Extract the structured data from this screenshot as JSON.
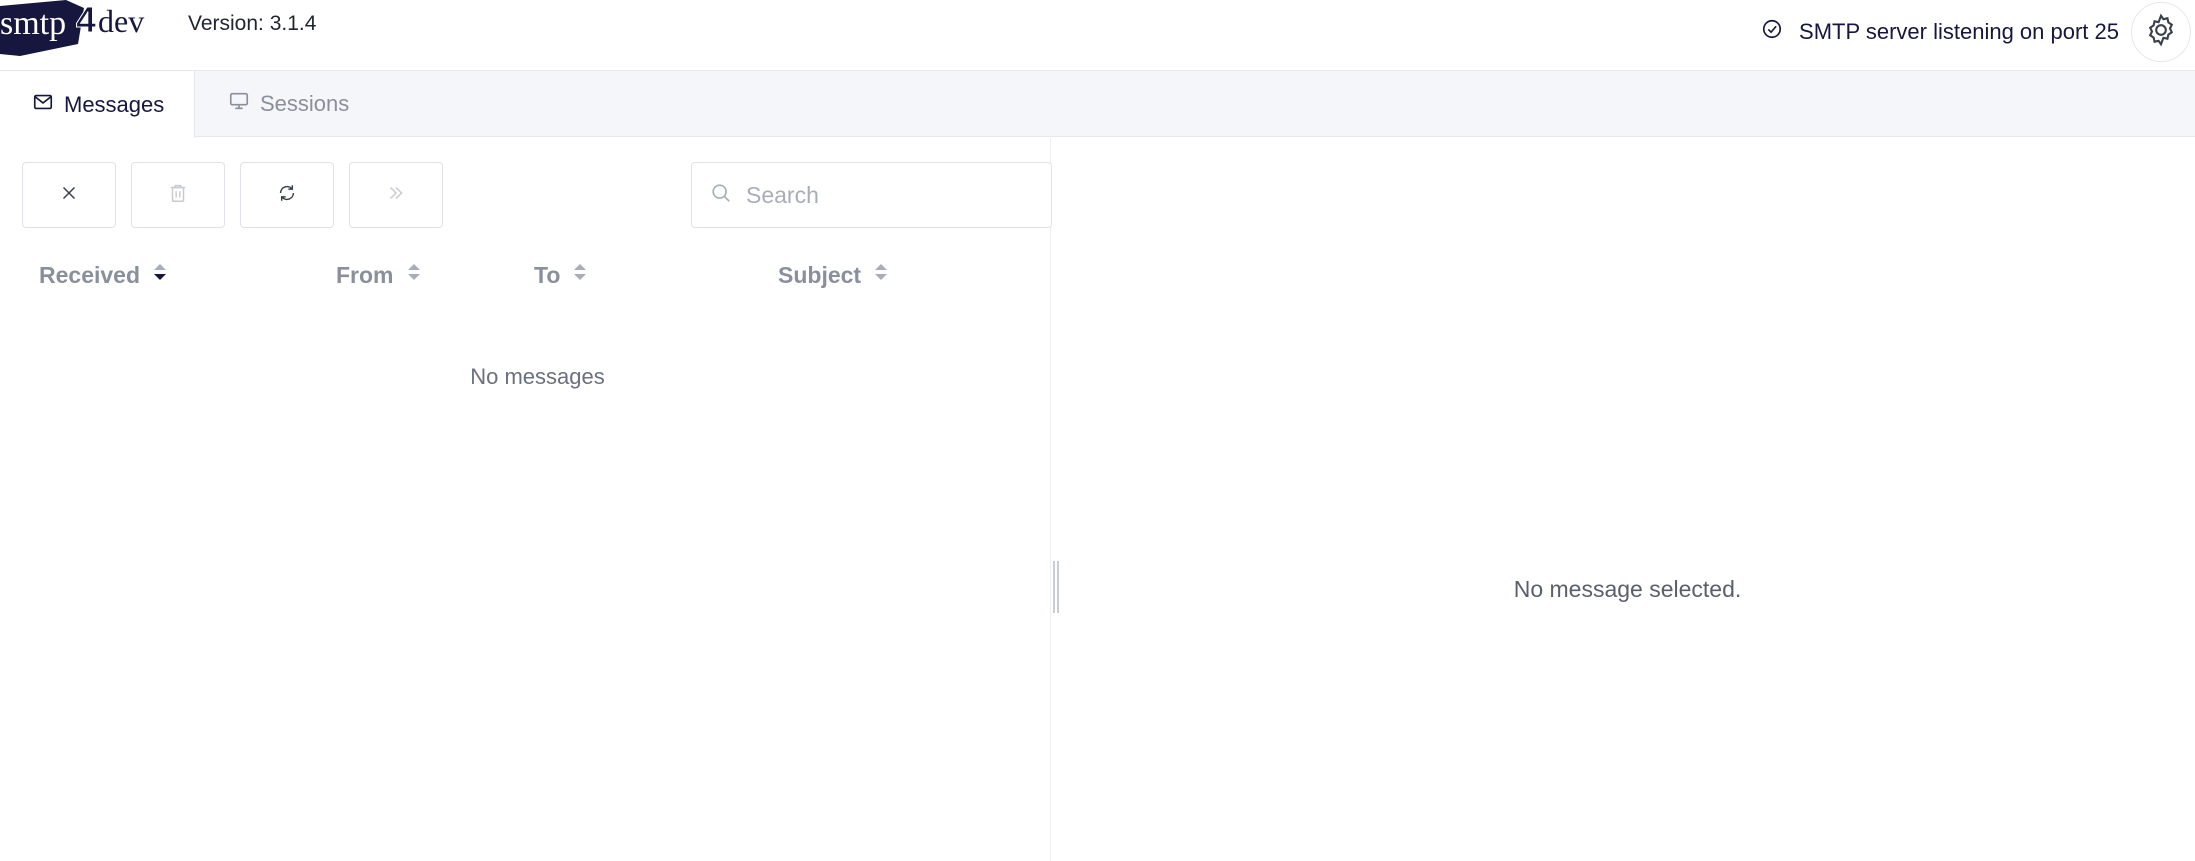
{
  "header": {
    "logo": {
      "text_main": "smtp",
      "text_digit": "4",
      "text_tail": "dev",
      "color": "#16163f"
    },
    "version": "Version: 3.1.4",
    "server_status": {
      "text": "SMTP server listening on port 25",
      "icon": "check-circle-icon"
    },
    "settings_icon": "gear-icon"
  },
  "tabs": [
    {
      "label": "Messages",
      "icon": "mail-icon",
      "active": true
    },
    {
      "label": "Sessions",
      "icon": "monitor-icon",
      "active": false
    }
  ],
  "toolbar": {
    "buttons": [
      {
        "name": "clear",
        "icon": "close-icon",
        "enabled": true
      },
      {
        "name": "delete",
        "icon": "trash-icon",
        "enabled": false
      },
      {
        "name": "refresh",
        "icon": "refresh-icon",
        "enabled": true
      },
      {
        "name": "relay",
        "icon": "double-chevron-right-icon",
        "enabled": false
      }
    ],
    "search": {
      "placeholder": "Search",
      "value": ""
    }
  },
  "message_list": {
    "columns": [
      {
        "label": "Received",
        "sort": "descending"
      },
      {
        "label": "From",
        "sort": "none"
      },
      {
        "label": "To",
        "sort": "none"
      },
      {
        "label": "Subject",
        "sort": "none"
      }
    ],
    "empty_text": "No messages"
  },
  "message_view": {
    "empty_text": "No message selected."
  },
  "colors": {
    "accent": "#16163f",
    "muted": "#8a8f9c",
    "border": "#dfe2e8"
  }
}
